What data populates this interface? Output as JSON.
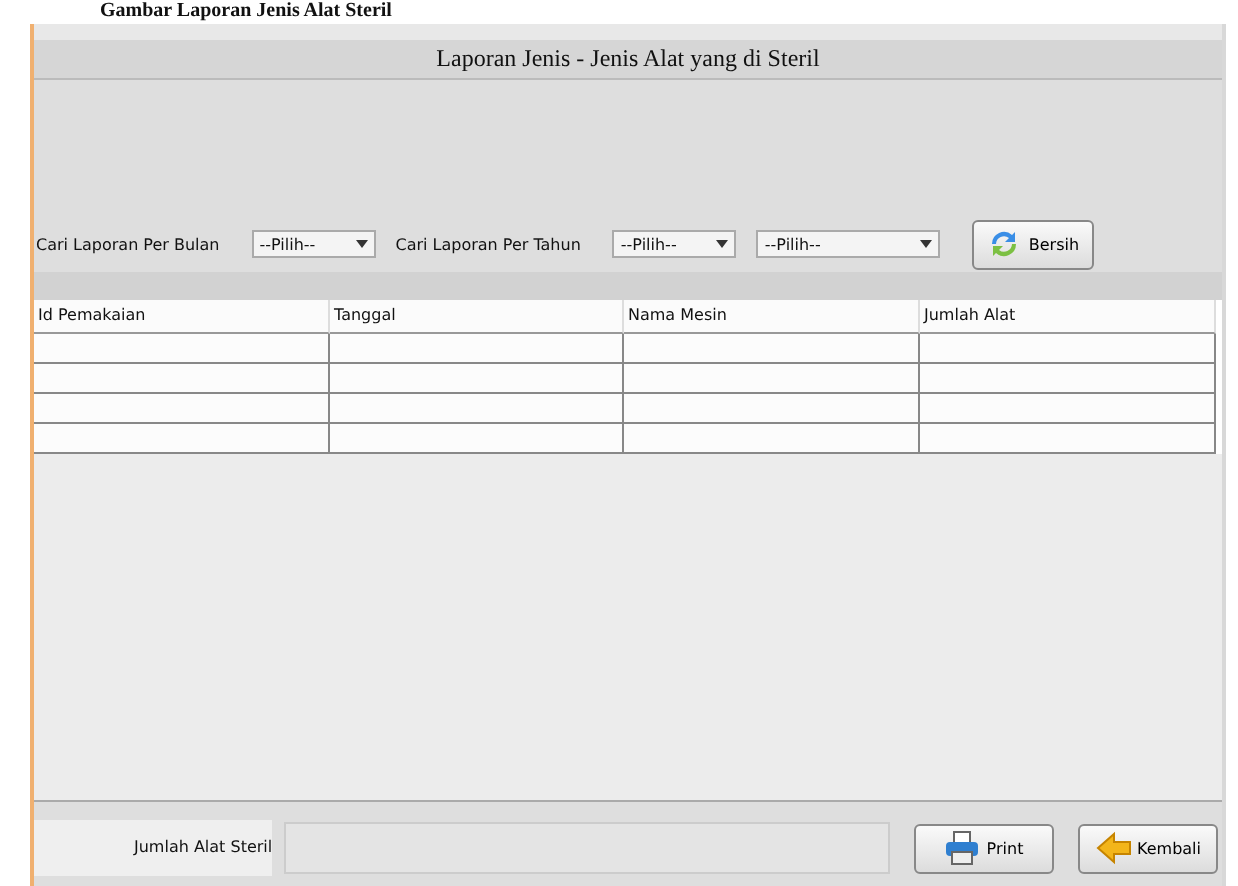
{
  "caption": "Gambar Laporan Jenis Alat Steril",
  "window": {
    "title": "Laporan Jenis - Jenis Alat yang di Steril"
  },
  "filters": [
    {
      "kind": "label",
      "text": "Cari Laporan Per Bulan"
    },
    {
      "kind": "combo",
      "value": "--Pilih--"
    },
    {
      "kind": "label",
      "text": "Cari Laporan Per Tahun"
    },
    {
      "kind": "combo",
      "value": "--Pilih--"
    },
    {
      "kind": "combo",
      "value": "--Pilih--"
    },
    {
      "kind": "button",
      "text": "Bersih"
    }
  ],
  "table": {
    "columns": [
      "Id Pemakaian",
      "Tanggal",
      "Nama Mesin",
      "Jumlah Alat"
    ],
    "rows": [
      {
        "selected": false
      },
      {
        "selected": false
      },
      {
        "selected": false
      },
      {
        "selected": false
      }
    ]
  },
  "footer": {
    "label": "Jumlah Alat Steril",
    "buttons": [
      {
        "text": "Print"
      },
      {
        "text": "Kembali"
      }
    ]
  }
}
